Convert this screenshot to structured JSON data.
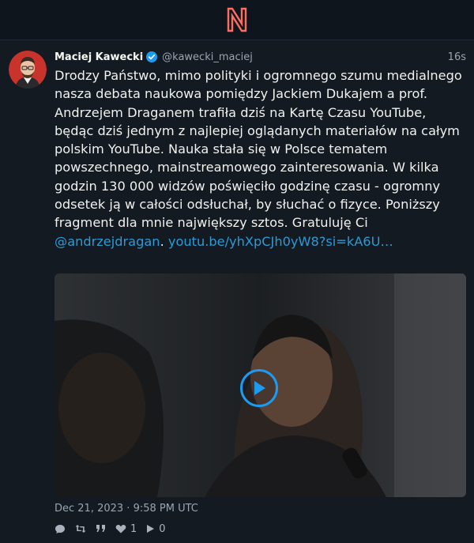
{
  "app": {
    "logo_letter": "N",
    "brand_color": "#ff6c60"
  },
  "tweet": {
    "fullname": "Maciej Kawecki",
    "username": "@kawecki_maciej",
    "time": "16s",
    "text_main": "Drodzy Państwo, mimo polityki i ogromnego szumu medialnego nasza debata naukowa pomiędzy Jackiem Dukajem a prof. Andrzejem Draganem trafiła dziś na Kartę Czasu YouTube, będąc dziś jednym z najlepiej oglądanych materiałów na całym polskim YouTube. Nauka stała się w Polsce tematem powszechnego, mainstreamowego zainteresowania. W kilka godzin 130 000 widzów poświęciło godzinę czasu - ogromny odsetek ją w całości odsłuchał, by słuchać o fizyce. Poniższy fragment dla mnie największy sztos. Gratuluję Ci ",
    "mention": "@andrzejdragan",
    "separator": ". ",
    "url": "youtu.be/yhXpCJh0yW8?si=kA6U…",
    "date": "Dec 21, 2023 · 9:58 PM UTC",
    "stats": {
      "likes": "1",
      "plays": "0"
    },
    "icons": [
      "comment-icon",
      "retweet-icon",
      "quote-icon",
      "heart-icon",
      "play-views-icon"
    ]
  },
  "colors": {
    "link": "#2b9bd8",
    "accent": "#1d9bf0",
    "background": "#131a22"
  }
}
